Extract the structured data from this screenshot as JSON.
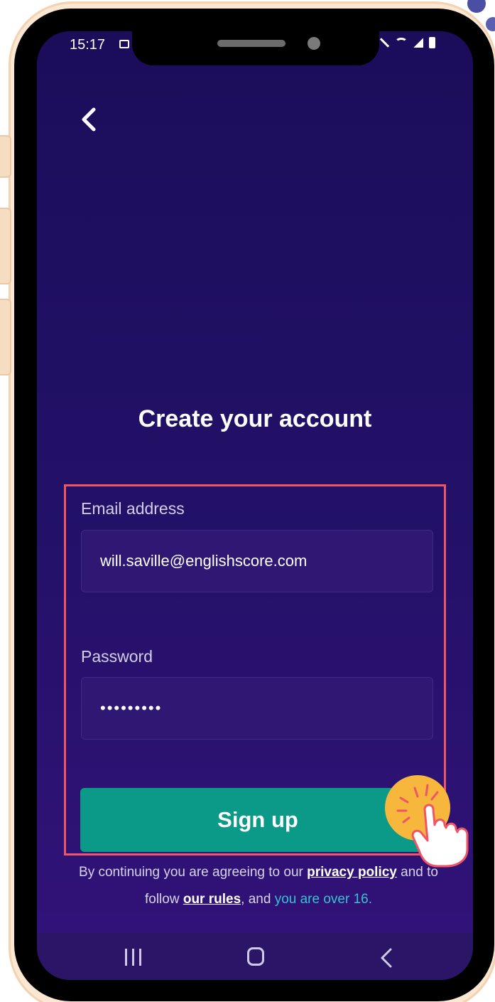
{
  "status_bar": {
    "time": "15:17"
  },
  "header": {
    "back_icon": "chevron-left-icon"
  },
  "page": {
    "title": "Create your account"
  },
  "form": {
    "email_label": "Email address",
    "email_value": "will.saville@englishscore.com",
    "password_label": "Password",
    "password_value": "•••••••••",
    "signup_label": "Sign up"
  },
  "legal": {
    "prefix": "By continuing you are agreeing to our ",
    "privacy_link": "privacy policy",
    "middle": " and to follow ",
    "rules_link": "our rules",
    "comma": ", and ",
    "age_text": "you are over 16."
  },
  "colors": {
    "background_top": "#1c0d5b",
    "background_bottom": "#33127a",
    "signup_button": "#0b9a88",
    "highlight_border": "#f05465",
    "accent_text": "#37c3d0",
    "tap_circle": "#f6b73c"
  },
  "navigation": {
    "icons": [
      "recent-apps-icon",
      "home-icon",
      "back-icon"
    ]
  }
}
